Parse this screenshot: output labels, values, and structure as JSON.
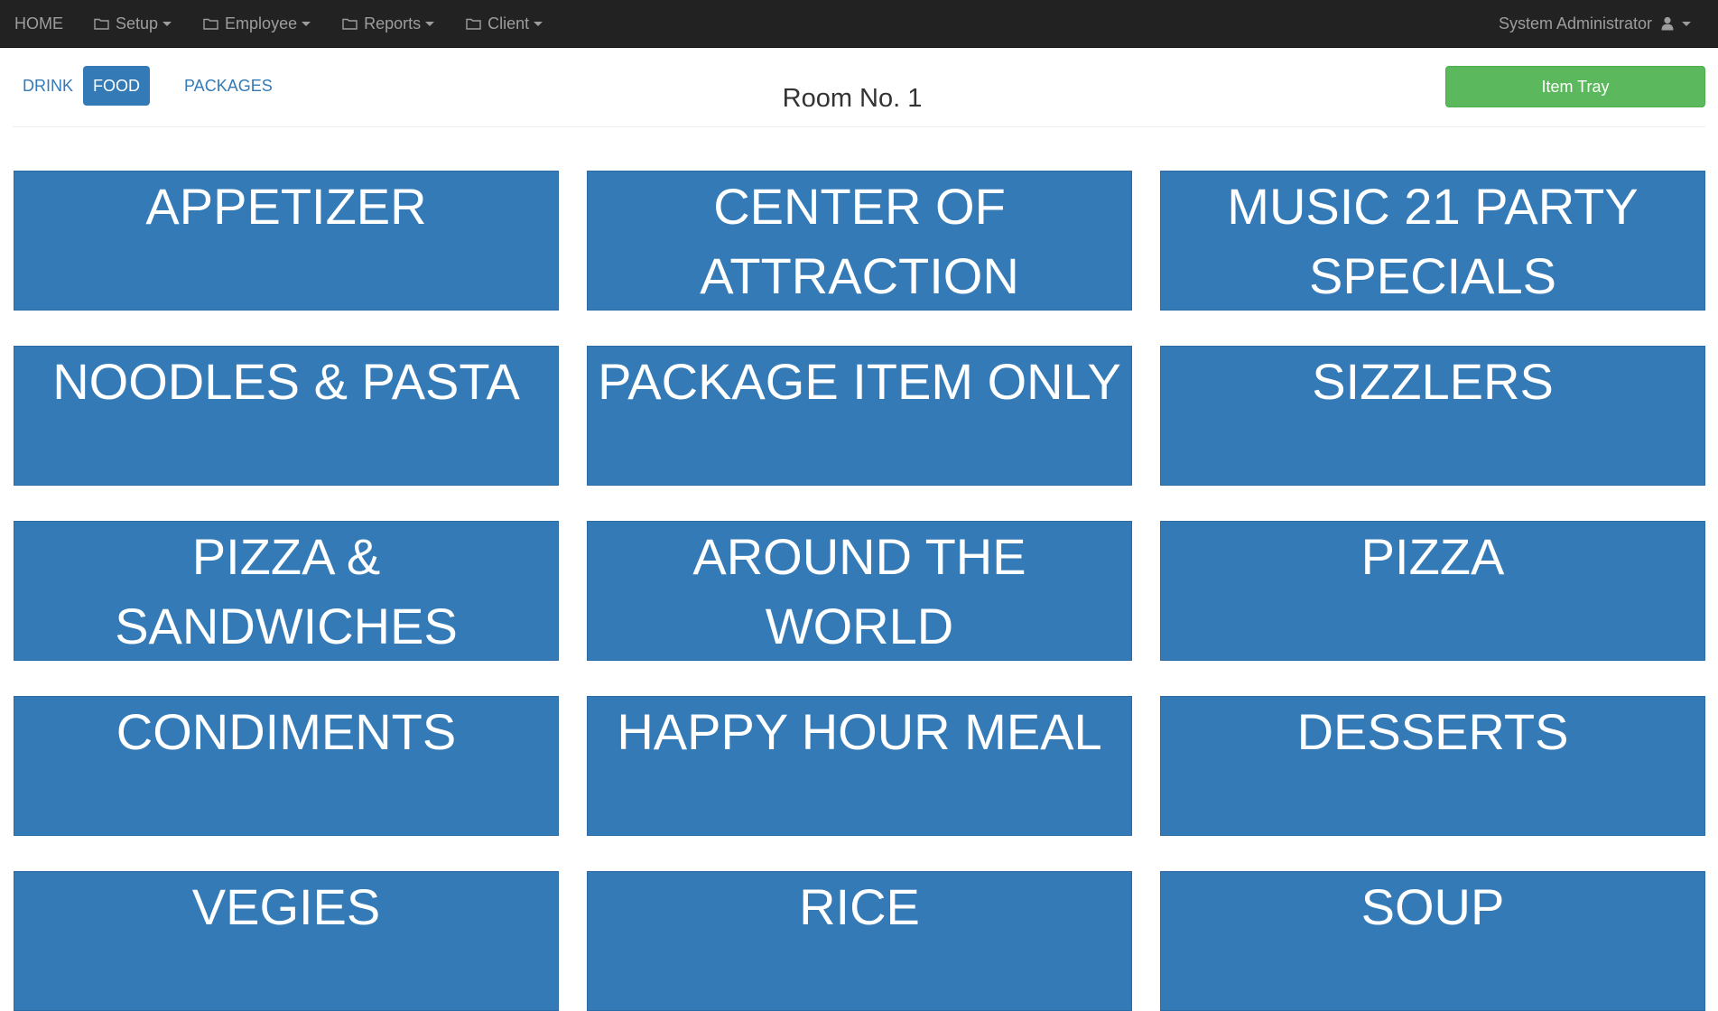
{
  "navbar": {
    "home": "HOME",
    "menus": [
      {
        "label": "Setup",
        "icon": "folder-icon"
      },
      {
        "label": "Employee",
        "icon": "folder-icon"
      },
      {
        "label": "Reports",
        "icon": "folder-icon"
      },
      {
        "label": "Client",
        "icon": "folder-icon"
      }
    ],
    "user": "System Administrator",
    "user_icon": "user-icon",
    "color": "#222222"
  },
  "tabs": [
    {
      "label": "DRINK",
      "active": false
    },
    {
      "label": "FOOD",
      "active": true
    },
    {
      "label": "PACKAGES",
      "active": false
    }
  ],
  "room_title": "Room No. 1",
  "item_tray": "Item Tray",
  "categories": [
    "APPETIZER",
    "CENTER OF ATTRACTION",
    "MUSIC 21 PARTY SPECIALS",
    "NOODLES & PASTA",
    "PACKAGE ITEM ONLY",
    "SIZZLERS",
    "PIZZA & SANDWICHES",
    "AROUND THE WORLD",
    "PIZZA",
    "CONDIMENTS",
    "HAPPY HOUR MEAL",
    "DESSERTS",
    "VEGIES",
    "RICE",
    "SOUP"
  ],
  "colors": {
    "primary": "#337ab7",
    "success": "#5cb85c",
    "navbar": "#222222"
  }
}
